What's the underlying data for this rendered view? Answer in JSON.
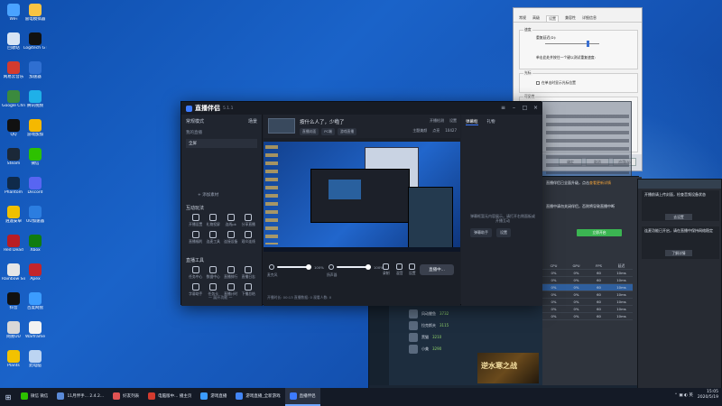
{
  "desktop_icons": [
    {
      "label": "WiFi",
      "color": "#4aa3ff",
      "icon": "wifi-icon"
    },
    {
      "label": "雷电模拟器",
      "color": "#f7c342",
      "icon": "emulator-icon"
    },
    {
      "label": "回收站",
      "color": "#d7e4f4",
      "icon": "recycle-bin-icon"
    },
    {
      "label": "Logitech G HUB",
      "color": "#111111",
      "icon": "ghub-icon"
    },
    {
      "label": "网易云音乐",
      "color": "#d33b2f",
      "icon": "music-icon"
    },
    {
      "label": "加速器",
      "color": "#2f6fd1",
      "icon": "accelerator-icon"
    },
    {
      "label": "Google Chrome",
      "color": "#3b8a3e",
      "icon": "chrome-icon"
    },
    {
      "label": "腾讯视频",
      "color": "#1fb0e8",
      "icon": "video-icon"
    },
    {
      "label": "QQ",
      "color": "#111111",
      "icon": "qq-icon"
    },
    {
      "label": "游戏加加",
      "color": "#f5b800",
      "icon": "gamepad-icon"
    },
    {
      "label": "Steam",
      "color": "#1b2838",
      "icon": "steam-icon"
    },
    {
      "label": "微信",
      "color": "#2dc100",
      "icon": "wechat-icon"
    },
    {
      "label": "Phantom",
      "color": "#0f2a4a",
      "icon": "phantom-icon"
    },
    {
      "label": "Discord",
      "color": "#5865f2",
      "icon": "discord-icon"
    },
    {
      "label": "逍遥安卓",
      "color": "#f0c000",
      "icon": "emulator2-icon"
    },
    {
      "label": "UU加速器",
      "color": "#2b7de0",
      "icon": "uu-icon"
    },
    {
      "label": "Red Dead",
      "color": "#b81d24",
      "icon": "game-red-icon"
    },
    {
      "label": "Xbox",
      "color": "#107c10",
      "icon": "xbox-icon"
    },
    {
      "label": "Rainbow Six",
      "color": "#e6e6e6",
      "icon": "r6-icon"
    },
    {
      "label": "Apex",
      "color": "#c3252b",
      "icon": "apex-icon"
    },
    {
      "label": "抖音",
      "color": "#111111",
      "icon": "tiktok-icon"
    },
    {
      "label": "百度网盘",
      "color": "#3b9cff",
      "icon": "cloud-icon"
    },
    {
      "label": "网易UU",
      "color": "#d8d8d8",
      "icon": "netease-icon"
    },
    {
      "label": "Warframe",
      "color": "#f2f2f2",
      "icon": "warframe-icon"
    },
    {
      "label": "Plants",
      "color": "#f2c200",
      "icon": "plants-icon"
    },
    {
      "label": "此电脑",
      "color": "#bcd4f2",
      "icon": "computer-icon"
    }
  ],
  "app": {
    "name": "直播伴侣",
    "version": "5.1.1",
    "scene_label": "常规模式",
    "scene_btn": "场景",
    "sources_label": "我的直播",
    "source_item": "全屏",
    "add_source": "+ 添加素材",
    "interact_title": "互动玩法",
    "interact_tools": [
      "开播设置",
      "礼物投屏",
      "连线pk",
      "分享直播",
      "直播福利",
      "连麦工具",
      "连接设备",
      "观众连线"
    ],
    "live_tools_title": "直播工具",
    "live_tools": [
      "任务中心",
      "数据中心",
      "直播排行",
      "直播日志",
      "字幕助手",
      "任务卡",
      "直播计时",
      "下播总结"
    ],
    "left_footer": "— 展开功能 —",
    "room_title": "按什么人了，少啦了",
    "edit_icon": "✎",
    "tags": [
      "直播封面",
      "PC端",
      "游戏直播"
    ],
    "head_right_top": [
      "开播检测",
      "设置"
    ],
    "head_right_bottom": [
      "主题美颜",
      "点亮",
      "10427"
    ],
    "mic_label": "麦克风",
    "mic_pct": "100%",
    "speaker_label": "扬声器",
    "speaker_pct": "100%",
    "bottom_icons": [
      "录制",
      "混音",
      "设置"
    ],
    "live_button": "直播中...",
    "main_footer": "开播时长: 00:13  直播数据: 0  观看人数: 0",
    "chat_tabs": [
      "弹幕框",
      "礼物"
    ],
    "chat_empty": "弹幕框暂无内容展示，请打开右侧面板或开播互动",
    "chat_buttons": [
      "弹幕助手",
      "设置"
    ]
  },
  "dialog": {
    "tabs": [
      "常规",
      "高级",
      "设置",
      "兼容性",
      "详细信息"
    ],
    "grp1_title": "速度",
    "grp1_line1": "重复延迟(D):",
    "grp1_line2": "重复速度(R):",
    "grp1_line3": "单击此处并按住一个键以测试重复速度:",
    "grp2_title": "光标",
    "grp2_line": "光标闪烁速度(B):",
    "grp2_check": "在单击时显示光标位置",
    "grp3_title": "可见性",
    "ok": "确定",
    "cancel": "取消",
    "apply": "应用(A)"
  },
  "assistant": {
    "notice_1": "直播伴侣已全面升级，点击",
    "notice_highlight": "查看更新详情",
    "notice_2": "直播中请勿关闭伴侣，否则将导致直播中断",
    "green_btn": "立即开启",
    "grid_headers": [
      "CPU",
      "GPU",
      "FPS",
      "延迟"
    ],
    "grid_rows": [
      [
        "0%",
        "0%",
        "60",
        "10ms"
      ],
      [
        "0%",
        "0%",
        "60",
        "10ms"
      ],
      [
        "0%",
        "0%",
        "60",
        "10ms"
      ],
      [
        "0%",
        "0%",
        "60",
        "10ms"
      ],
      [
        "0%",
        "0%",
        "60",
        "10ms"
      ],
      [
        "0%",
        "0%",
        "60",
        "10ms"
      ],
      [
        "0%",
        "0%",
        "60",
        "10ms"
      ]
    ],
    "side_items": [
      {
        "name": "风动鲤鱼",
        "tag": "3732"
      },
      {
        "name": "拉克斯夫",
        "tag": "3115"
      },
      {
        "name": "黑猫",
        "tag": "3210"
      },
      {
        "name": "小美",
        "tag": "3290"
      }
    ],
    "banner": "逆水寒之战"
  },
  "popup": {
    "card1": "开播前请上传封面，检查音频设备状态",
    "card1_btn": "去设置",
    "card2": "连麦功能已开启，请在直播中保持网络稳定",
    "card2_btn": "了解详情"
  },
  "taskbar": {
    "items": [
      {
        "label": "微信 微信",
        "color": "#2dc100",
        "active": false
      },
      {
        "label": "11月伴手... 2.4.2...",
        "color": "#5a8ad8",
        "active": false
      },
      {
        "label": "好友列表",
        "color": "#e05353",
        "active": false
      },
      {
        "label": "电脑版中... 播主页",
        "color": "#d33b2f",
        "active": false
      },
      {
        "label": "游戏直播",
        "color": "#3b9cff",
        "active": false
      },
      {
        "label": "游戏直播_全新游戏",
        "color": "#4285f4",
        "active": false
      },
      {
        "label": "直播伴侣",
        "color": "#3d7bff",
        "active": true
      }
    ],
    "tray_icons": "⌃ ▣ ◐ 英",
    "time": "15:05",
    "date": "2020/5/19"
  }
}
